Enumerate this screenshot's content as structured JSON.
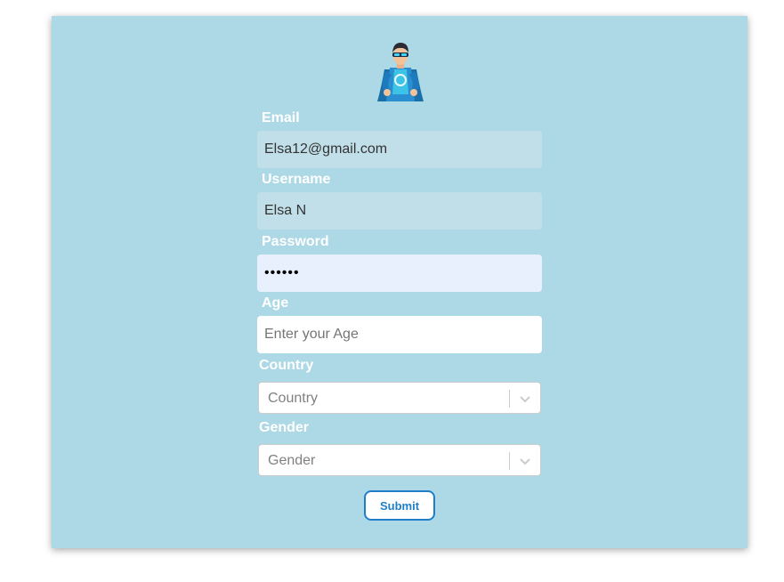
{
  "form": {
    "email": {
      "label": "Email",
      "value": "Elsa12@gmail.com"
    },
    "username": {
      "label": "Username",
      "value": "Elsa N"
    },
    "password": {
      "label": "Password",
      "value": "••••••"
    },
    "age": {
      "label": "Age",
      "value": "",
      "placeholder": "Enter your Age"
    },
    "country": {
      "label": "Country",
      "placeholder": "Country"
    },
    "gender": {
      "label": "Gender",
      "placeholder": "Gender"
    },
    "submit_label": "Submit"
  },
  "icons": {
    "avatar": "superhero-avatar-icon",
    "select_arrow": "chevron-down-icon"
  },
  "colors": {
    "card_background": "#add8e6",
    "accent": "#1e7fc8",
    "autofill_background": "#e8f0fe"
  }
}
